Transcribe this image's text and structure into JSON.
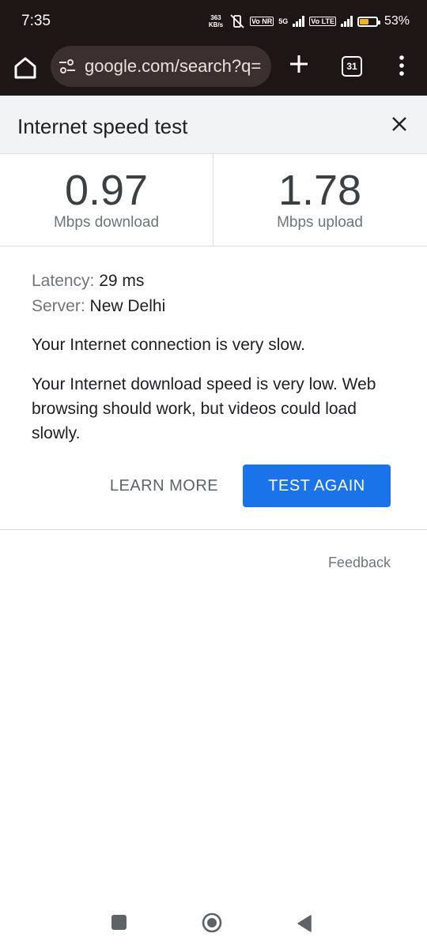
{
  "status_bar": {
    "time": "7:35",
    "net_speed": "363",
    "net_unit": "KB/s",
    "sim1": "Vo NR",
    "net_type": "5G",
    "sim2": "Vo LTE",
    "battery_level": 0.53,
    "battery_text": "53%",
    "battery_color": "#f0b323"
  },
  "browser": {
    "url": "google.com/search?q=",
    "tab_count": "31",
    "icons": [
      "home-icon",
      "site-settings-icon",
      "new-tab-icon",
      "tab-switcher-icon",
      "more-menu-icon"
    ]
  },
  "panel": {
    "title": "Internet speed test",
    "download": {
      "value": "0.97",
      "label": "Mbps download"
    },
    "upload": {
      "value": "1.78",
      "label": "Mbps upload"
    },
    "latency_key": "Latency:",
    "latency_value": "29 ms",
    "server_key": "Server:",
    "server_value": "New Delhi",
    "summary": "Your Internet connection is very slow.",
    "detail": "Your Internet download speed is very low. Web browsing should work, but videos could load slowly.",
    "learn_more_label": "LEARN MORE",
    "test_again_label": "TEST AGAIN",
    "accent_color": "#1a73e8",
    "feedback_label": "Feedback"
  }
}
